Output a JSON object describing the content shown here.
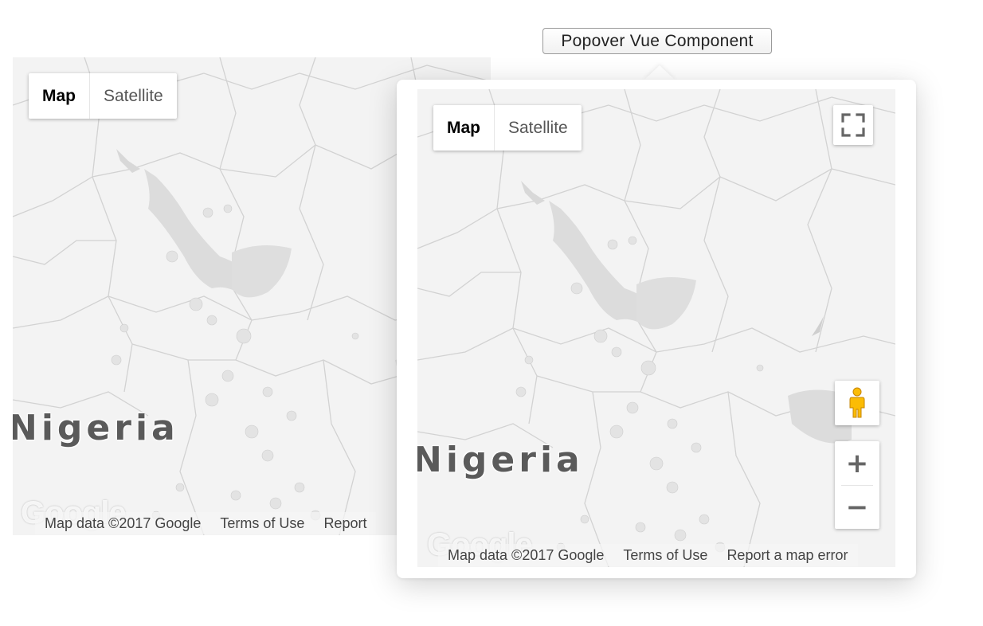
{
  "trigger": {
    "label": "Popover Vue Component"
  },
  "bg_map": {
    "map_type": {
      "map": "Map",
      "satellite": "Satellite",
      "active": "Map"
    },
    "country_label": "Nigeria",
    "logo": "Google",
    "attribution": {
      "data": "Map data ©2017 Google",
      "terms": "Terms of Use",
      "report": "Report"
    }
  },
  "popover_map": {
    "map_type": {
      "map": "Map",
      "satellite": "Satellite",
      "active": "Map"
    },
    "country_label": "Nigeria",
    "logo": "Google",
    "attribution": {
      "data": "Map data ©2017 Google",
      "terms": "Terms of Use",
      "report": "Report a map error"
    },
    "controls": {
      "fullscreen_icon": "fullscreen-icon",
      "pegman_icon": "pegman-icon",
      "zoom_in": "+",
      "zoom_out": "−"
    }
  },
  "colors": {
    "map_bg": "#f3f3f3",
    "water": "#dedede",
    "borders": "#cfcfcf",
    "pegman": "#fbbc05"
  }
}
